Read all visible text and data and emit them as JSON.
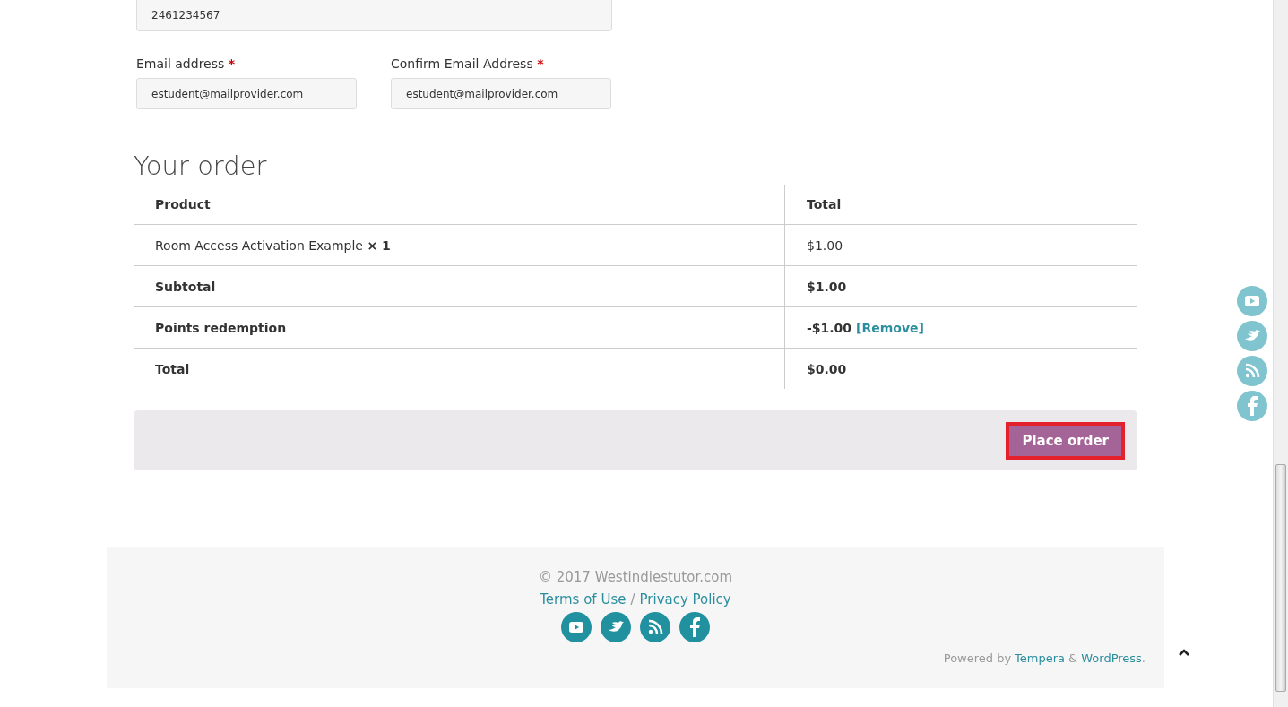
{
  "phone_field": {
    "value": "2461234567"
  },
  "email_fields": [
    {
      "label": "Email address",
      "required_mark": "*",
      "value": "estudent@mailprovider.com"
    },
    {
      "label": "Confirm Email Address",
      "required_mark": "*",
      "value": "estudent@mailprovider.com"
    }
  ],
  "order": {
    "heading": "Your order",
    "columns": [
      "Product",
      "Total"
    ],
    "rows": [
      {
        "kind": "item",
        "label": "Room Access Activation Example",
        "quantity": "× 1",
        "total": "$1.00"
      },
      {
        "kind": "summary",
        "label": "Subtotal",
        "total": "$1.00"
      },
      {
        "kind": "summary",
        "label": "Points redemption",
        "total": "-$1.00",
        "link": "[Remove]"
      },
      {
        "kind": "summary",
        "label": "Total",
        "total": "$0.00"
      }
    ]
  },
  "place_order_button": {
    "label": "Place order",
    "highlighted": true
  },
  "footer": {
    "copyright": "© 2017 Westindiestutor.com",
    "links": [
      "Terms of Use",
      "Privacy Policy"
    ],
    "separator": "/",
    "powered_by": "Powered by",
    "theme_link": "Tempera",
    "ampersand": "&",
    "platform_link": "WordPress",
    "period": "."
  }
}
